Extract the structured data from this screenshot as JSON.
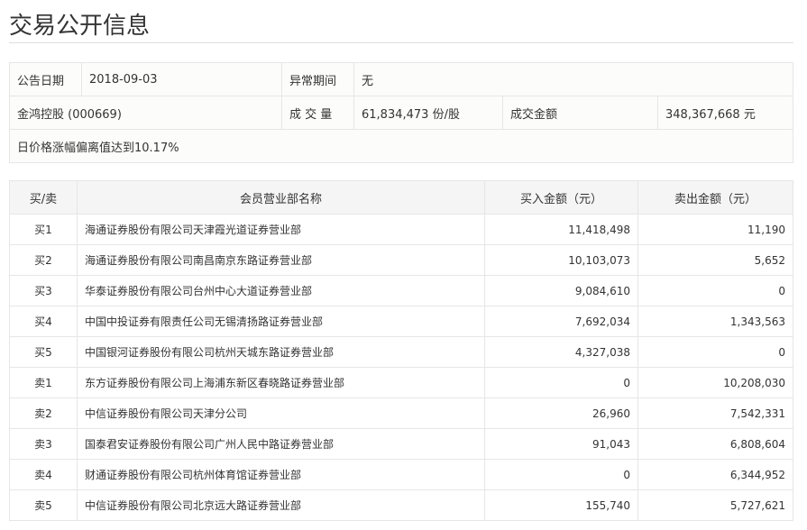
{
  "title": "交易公开信息",
  "info": {
    "date_label": "公告日期",
    "date_value": "2018-09-03",
    "period_label": "异常期间",
    "period_value": "无",
    "stock": "金鸿控股 (000669)",
    "volume_label": "成 交 量",
    "volume_value": "61,834,473 份/股",
    "amount_label": "成交金额",
    "amount_value": "348,367,668 元",
    "reason": "日价格涨幅偏离值达到10.17%"
  },
  "table": {
    "headers": [
      "买/卖",
      "会员营业部名称",
      "买入金额（元）",
      "卖出金额（元）"
    ],
    "rows": [
      {
        "side": "买1",
        "name": "海通证券股份有限公司天津霞光道证券营业部",
        "buy": "11,418,498",
        "sell": "11,190"
      },
      {
        "side": "买2",
        "name": "海通证券股份有限公司南昌南京东路证券营业部",
        "buy": "10,103,073",
        "sell": "5,652"
      },
      {
        "side": "买3",
        "name": "华泰证券股份有限公司台州中心大道证券营业部",
        "buy": "9,084,610",
        "sell": "0"
      },
      {
        "side": "买4",
        "name": "中国中投证券有限责任公司无锡清扬路证券营业部",
        "buy": "7,692,034",
        "sell": "1,343,563"
      },
      {
        "side": "买5",
        "name": "中国银河证券股份有限公司杭州天城东路证券营业部",
        "buy": "4,327,038",
        "sell": "0"
      },
      {
        "side": "卖1",
        "name": "东方证券股份有限公司上海浦东新区春晓路证券营业部",
        "buy": "0",
        "sell": "10,208,030"
      },
      {
        "side": "卖2",
        "name": "中信证券股份有限公司天津分公司",
        "buy": "26,960",
        "sell": "7,542,331"
      },
      {
        "side": "卖3",
        "name": "国泰君安证券股份有限公司广州人民中路证券营业部",
        "buy": "91,043",
        "sell": "6,808,604"
      },
      {
        "side": "卖4",
        "name": "财通证券股份有限公司杭州体育馆证券营业部",
        "buy": "0",
        "sell": "6,344,952"
      },
      {
        "side": "卖5",
        "name": "中信证券股份有限公司北京远大路证券营业部",
        "buy": "155,740",
        "sell": "5,727,621"
      }
    ]
  }
}
